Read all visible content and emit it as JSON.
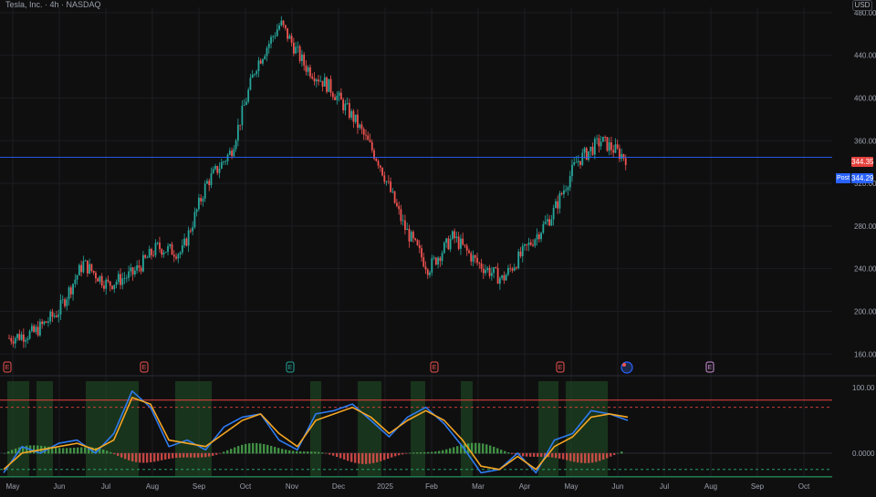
{
  "header": {
    "symbol_title": "Tesla, Inc. · 4h · NASDAQ",
    "currency": "USD"
  },
  "price_axis": {
    "ticks": [
      "480.00",
      "440.00",
      "400.00",
      "360.00",
      "320.00",
      "280.00",
      "240.00",
      "200.00",
      "160.00"
    ],
    "last_price": "344.35",
    "prev_price": "344.29",
    "prev_label": "Post"
  },
  "oscillator_axis": {
    "ticks": [
      "100.00",
      "0.0000"
    ]
  },
  "time_axis": {
    "labels": [
      "May",
      "Jun",
      "Jul",
      "Aug",
      "Sep",
      "Oct",
      "Nov",
      "Dec",
      "2025",
      "Feb",
      "Mar",
      "Apr",
      "May",
      "Jun",
      "Jul",
      "Aug",
      "Sep",
      "Oct"
    ]
  },
  "event_markers": [
    "E",
    "E",
    "E",
    "E",
    "E",
    "E"
  ],
  "colors": {
    "background": "#0f0f10",
    "up": "#26a69a",
    "down": "#ef5350",
    "fast_line": "#2f7bf0",
    "slow_line": "#f5a623",
    "overbought": "#e4423d",
    "oversold": "#2bb673",
    "zone_fill": "#1f4d25",
    "price_line": "#2962ff"
  },
  "chart_data": [
    {
      "type": "line",
      "title": "",
      "xlabel": "",
      "ylabel": "",
      "x": [
        "May",
        "Jun",
        "Jul",
        "Aug",
        "Sep",
        "Oct",
        "Nov",
        "Dec",
        "2025",
        "Feb",
        "Mar",
        "Apr",
        "May",
        "Jun"
      ],
      "series": [
        {
          "values": [
            175,
            180,
            200,
            245,
            225,
            235,
            260,
            255,
            320,
            350,
            430,
            470,
            430,
            410,
            380,
            340,
            280,
            240,
            270,
            245,
            230,
            260,
            290,
            340,
            360,
            344
          ]
        }
      ],
      "ylim": [
        150,
        485
      ],
      "last": 344.35,
      "prev": 344.29
    },
    {
      "type": "line",
      "title": "",
      "ylim": [
        -35,
        110
      ],
      "overbought": 70,
      "oversold": -25,
      "series": [
        {
          "values": [
            -30,
            10,
            0,
            15,
            20,
            0,
            30,
            95,
            70,
            10,
            20,
            5,
            40,
            55,
            60,
            20,
            5,
            60,
            65,
            75,
            50,
            25,
            55,
            70,
            45,
            10,
            -30,
            -25,
            0,
            -30,
            20,
            30,
            65,
            60,
            50
          ]
        },
        {
          "values": [
            -25,
            0,
            5,
            10,
            15,
            5,
            20,
            85,
            75,
            20,
            15,
            10,
            30,
            50,
            60,
            30,
            10,
            50,
            60,
            70,
            55,
            30,
            50,
            65,
            50,
            20,
            -20,
            -25,
            -5,
            -25,
            10,
            25,
            55,
            60,
            55
          ]
        }
      ]
    }
  ]
}
